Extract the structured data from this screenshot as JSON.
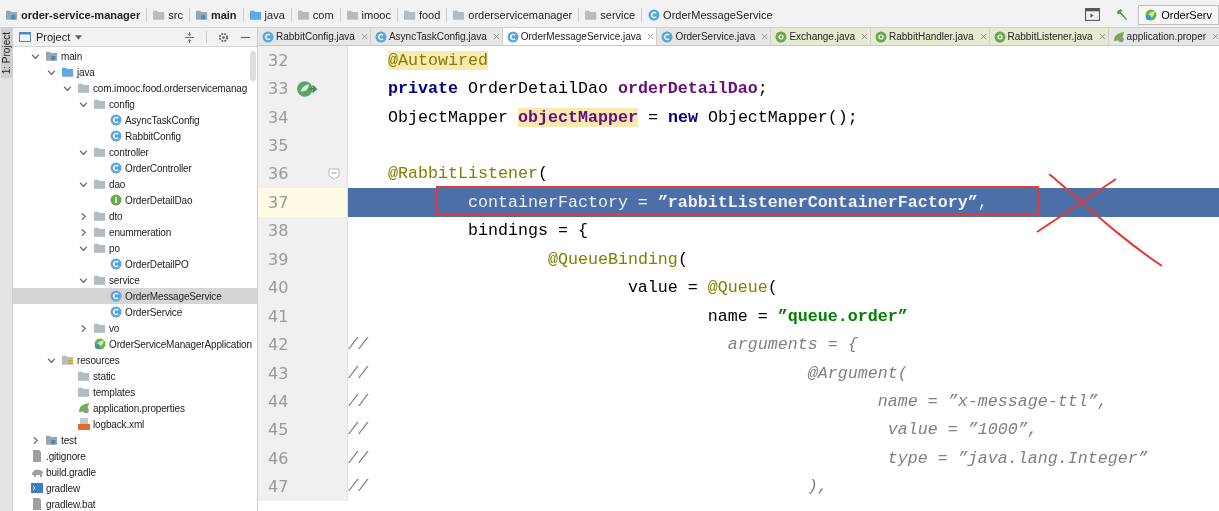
{
  "breadcrumbs": [
    {
      "label": "order-service-manager",
      "kind": "module"
    },
    {
      "label": "src",
      "kind": "folder"
    },
    {
      "label": "main",
      "kind": "module"
    },
    {
      "label": "java",
      "kind": "source"
    },
    {
      "label": "com",
      "kind": "folder"
    },
    {
      "label": "imooc",
      "kind": "folder"
    },
    {
      "label": "food",
      "kind": "folder"
    },
    {
      "label": "orderservicemanager",
      "kind": "folder"
    },
    {
      "label": "service",
      "kind": "folder"
    },
    {
      "label": "OrderMessageService",
      "kind": "class"
    }
  ],
  "run_config": {
    "label": "OrderServ"
  },
  "side_strip": {
    "label": "1: Project"
  },
  "project_panel": {
    "title": "Project",
    "tree": [
      {
        "label": "main",
        "kind": "module",
        "expanded": true,
        "selected": false,
        "children": [
          {
            "label": "java",
            "kind": "source",
            "expanded": true,
            "selected": false,
            "children": [
              {
                "label": "com.imooc.food.orderservicemanag",
                "kind": "folder",
                "expanded": true,
                "selected": false,
                "children": [
                  {
                    "label": "config",
                    "kind": "folder",
                    "expanded": true,
                    "selected": false,
                    "children": [
                      {
                        "label": "AsyncTaskConfig",
                        "kind": "class",
                        "selected": false
                      },
                      {
                        "label": "RabbitConfig",
                        "kind": "class",
                        "selected": false
                      }
                    ]
                  },
                  {
                    "label": "controller",
                    "kind": "folder",
                    "expanded": true,
                    "selected": false,
                    "children": [
                      {
                        "label": "OrderController",
                        "kind": "class",
                        "selected": false
                      }
                    ]
                  },
                  {
                    "label": "dao",
                    "kind": "folder",
                    "expanded": true,
                    "selected": false,
                    "children": [
                      {
                        "label": "OrderDetailDao",
                        "kind": "interface",
                        "selected": false
                      }
                    ]
                  },
                  {
                    "label": "dto",
                    "kind": "folder",
                    "expanded": false,
                    "selected": false
                  },
                  {
                    "label": "enummeration",
                    "kind": "folder",
                    "expanded": false,
                    "selected": false
                  },
                  {
                    "label": "po",
                    "kind": "folder",
                    "expanded": true,
                    "selected": false,
                    "children": [
                      {
                        "label": "OrderDetailPO",
                        "kind": "class",
                        "selected": false
                      }
                    ]
                  },
                  {
                    "label": "service",
                    "kind": "folder",
                    "expanded": true,
                    "selected": false,
                    "children": [
                      {
                        "label": "OrderMessageService",
                        "kind": "class",
                        "selected": true
                      },
                      {
                        "label": "OrderService",
                        "kind": "class",
                        "selected": false
                      }
                    ]
                  },
                  {
                    "label": "vo",
                    "kind": "folder",
                    "expanded": false,
                    "selected": false
                  },
                  {
                    "label": "OrderServiceManagerApplication",
                    "kind": "spring",
                    "selected": false
                  }
                ]
              }
            ]
          },
          {
            "label": "resources",
            "kind": "resources",
            "expanded": true,
            "selected": false,
            "children": [
              {
                "label": "static",
                "kind": "folder",
                "selected": false
              },
              {
                "label": "templates",
                "kind": "folder",
                "selected": false
              },
              {
                "label": "application.properties",
                "kind": "properties",
                "selected": false
              },
              {
                "label": "logback.xml",
                "kind": "xml",
                "selected": false
              }
            ]
          }
        ]
      },
      {
        "label": "test",
        "kind": "module",
        "expanded": false,
        "selected": false
      },
      {
        "label": ".gitignore",
        "kind": "file",
        "selected": false
      },
      {
        "label": "build.gradle",
        "kind": "gradle",
        "selected": false
      },
      {
        "label": "gradlew",
        "kind": "script",
        "selected": false
      },
      {
        "label": "gradlew.bat",
        "kind": "file",
        "selected": false
      }
    ]
  },
  "tabs": [
    {
      "label": "RabbitConfig.java",
      "kind": "class",
      "selected": false
    },
    {
      "label": "AsyncTaskConfig.java",
      "kind": "class",
      "selected": false
    },
    {
      "label": "OrderMessageService.java",
      "kind": "class",
      "selected": true
    },
    {
      "label": "OrderService.java",
      "kind": "class",
      "selected": false
    },
    {
      "label": "Exchange.java",
      "kind": "annotation",
      "selected": false
    },
    {
      "label": "RabbitHandler.java",
      "kind": "annotation",
      "selected": false
    },
    {
      "label": "RabbitListener.java",
      "kind": "annotation",
      "selected": false
    },
    {
      "label": "application.proper",
      "kind": "properties",
      "selected": false
    }
  ],
  "editor": {
    "lines": [
      {
        "number": "32",
        "kind": "code",
        "selected": false,
        "tokens": [
          {
            "kind": "annotation-marked",
            "text": "    @Autowired"
          }
        ]
      },
      {
        "number": "33",
        "kind": "bean",
        "selected": false,
        "tokens": [
          {
            "kind": "keyword",
            "text": "    private"
          },
          {
            "kind": "plain",
            "text": " OrderDetailDao "
          },
          {
            "kind": "field",
            "text": "orderDetailDao"
          },
          {
            "kind": "plain",
            "text": ";"
          }
        ]
      },
      {
        "number": "34",
        "kind": "code",
        "selected": false,
        "tokens": [
          {
            "kind": "plain",
            "text": "    ObjectMapper "
          },
          {
            "kind": "field-marked",
            "text": "objectMapper"
          },
          {
            "kind": "plain",
            "text": " = "
          },
          {
            "kind": "keyword",
            "text": "new"
          },
          {
            "kind": "plain",
            "text": " ObjectMapper();"
          }
        ]
      },
      {
        "number": "35",
        "kind": "code",
        "selected": false
      },
      {
        "number": "36",
        "kind": "fold",
        "selected": false,
        "tokens": [
          {
            "kind": "annotation",
            "text": "    @RabbitListener"
          },
          {
            "kind": "plain",
            "text": "("
          }
        ]
      },
      {
        "number": "37",
        "kind": "code",
        "selected": true,
        "tokens": [
          {
            "kind": "plain",
            "text": "            containerFactory = "
          },
          {
            "kind": "string",
            "text": "”rabbitListenerContainerFactory”"
          },
          {
            "kind": "plain",
            "text": ","
          }
        ]
      },
      {
        "number": "38",
        "kind": "code",
        "selected": false,
        "tokens": [
          {
            "kind": "plain",
            "text": "            bindings = {"
          }
        ]
      },
      {
        "number": "39",
        "kind": "code",
        "selected": false,
        "tokens": [
          {
            "kind": "annotation",
            "text": "                    @QueueBinding"
          },
          {
            "kind": "plain",
            "text": "("
          }
        ]
      },
      {
        "number": "40",
        "kind": "code",
        "selected": false,
        "tokens": [
          {
            "kind": "plain",
            "text": "                            value = "
          },
          {
            "kind": "annotation",
            "text": "@Queue"
          },
          {
            "kind": "plain",
            "text": "("
          }
        ]
      },
      {
        "number": "41",
        "kind": "code",
        "selected": false,
        "tokens": [
          {
            "kind": "plain",
            "text": "                                    name = "
          },
          {
            "kind": "string",
            "text": "”queue.order”"
          }
        ]
      },
      {
        "number": "42",
        "kind": "code",
        "selected": false,
        "tokens": [
          {
            "kind": "comment",
            "text": "//"
          },
          {
            "kind": "comment",
            "text": "                                    arguments = {"
          }
        ]
      },
      {
        "number": "43",
        "kind": "code",
        "selected": false,
        "tokens": [
          {
            "kind": "comment",
            "text": "//"
          },
          {
            "kind": "comment",
            "text": "                                            @Argument("
          }
        ]
      },
      {
        "number": "44",
        "kind": "code",
        "selected": false,
        "tokens": [
          {
            "kind": "comment",
            "text": "//"
          },
          {
            "kind": "comment",
            "text": "                                                   name = ”x-message-ttl”,"
          }
        ]
      },
      {
        "number": "45",
        "kind": "code",
        "selected": false,
        "tokens": [
          {
            "kind": "comment",
            "text": "//"
          },
          {
            "kind": "comment",
            "text": "                                                    value = ”1000”,"
          }
        ]
      },
      {
        "number": "46",
        "kind": "code",
        "selected": false,
        "tokens": [
          {
            "kind": "comment",
            "text": "//"
          },
          {
            "kind": "comment",
            "text": "                                                    type = ”java.lang.Integer”"
          }
        ]
      },
      {
        "number": "47",
        "kind": "code",
        "selected": false,
        "tokens": [
          {
            "kind": "comment",
            "text": "//"
          },
          {
            "kind": "comment",
            "text": "                                            ),"
          }
        ]
      }
    ]
  }
}
